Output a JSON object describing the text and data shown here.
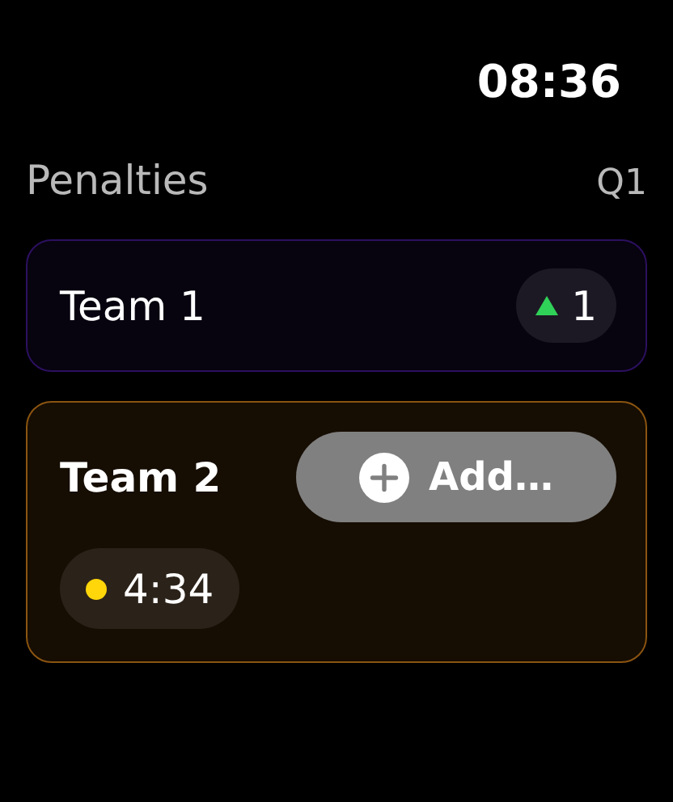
{
  "status_bar": {
    "time": "08:36"
  },
  "header": {
    "title": "Penalties",
    "period": "Q1"
  },
  "teams": [
    {
      "name": "Team 1",
      "color": "#2c1060",
      "selected": false,
      "penalties": [
        {
          "kind": "count",
          "text": "1"
        }
      ]
    },
    {
      "name": "Team 2",
      "color": "#8a5410",
      "selected": true,
      "action": "Add…",
      "penalties": [
        {
          "kind": "timer",
          "text": "4:34"
        }
      ]
    }
  ]
}
